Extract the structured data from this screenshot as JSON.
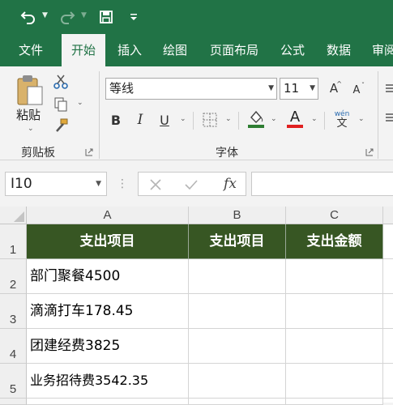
{
  "qat": {
    "icons": [
      "undo-icon",
      "redo-icon",
      "save-icon",
      "customize-qat-icon"
    ]
  },
  "tabs": [
    {
      "label": "文件",
      "active": false
    },
    {
      "label": "开始",
      "active": true
    },
    {
      "label": "插入",
      "active": false
    },
    {
      "label": "绘图",
      "active": false
    },
    {
      "label": "页面布局",
      "active": false
    },
    {
      "label": "公式",
      "active": false
    },
    {
      "label": "数据",
      "active": false
    },
    {
      "label": "审阅",
      "active": false
    }
  ],
  "ribbon": {
    "clipboard": {
      "paste_label": "粘贴",
      "group_label": "剪贴板"
    },
    "font": {
      "font_name": "等线",
      "font_size": "11",
      "group_label": "字体",
      "bold": "B",
      "italic": "I",
      "underline": "U",
      "font_color_glyph": "A",
      "pinyin_top": "wén",
      "pinyin_bottom": "文",
      "grow_glyph": "A",
      "shrink_glyph": "A",
      "font_color": "#e02020",
      "fill_color": "#2e7d32"
    }
  },
  "formula_bar": {
    "name_box": "I10",
    "fx": "fx",
    "formula": ""
  },
  "sheet": {
    "columns": [
      "A",
      "B",
      "C"
    ],
    "rows": [
      "1",
      "2",
      "3",
      "4",
      "5"
    ],
    "header": [
      "支出项目",
      "支出项目",
      "支出金额"
    ],
    "data": [
      [
        "部门聚餐4500",
        "",
        ""
      ],
      [
        "滴滴打车178.45",
        "",
        ""
      ],
      [
        "团建经费3825",
        "",
        ""
      ],
      [
        "业务招待费3542.35",
        "",
        ""
      ]
    ],
    "header_fill": "#375623"
  }
}
